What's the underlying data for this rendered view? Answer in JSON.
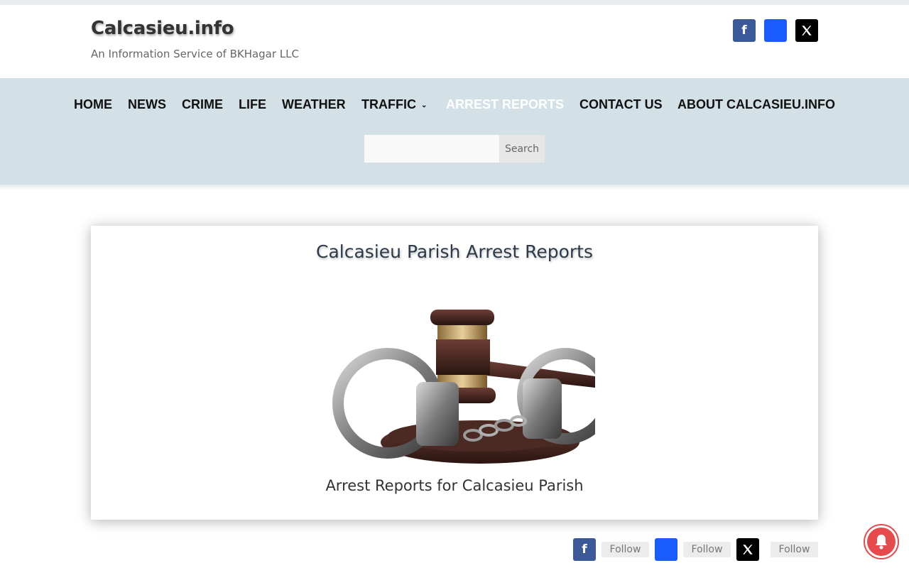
{
  "site": {
    "title": "Calcasieu.info",
    "tagline": "An Information Service of BKHagar LLC"
  },
  "header_social": [
    {
      "icon": "facebook-icon",
      "glyph": "f",
      "color": "#3b5998"
    },
    {
      "icon": "bluesky-icon",
      "glyph": "",
      "color": "#1b5cff"
    },
    {
      "icon": "x-icon",
      "glyph": "𝕏",
      "color": "#000000"
    }
  ],
  "nav": {
    "background": "#d3e0e5",
    "items": [
      {
        "label": "HOME",
        "active": false
      },
      {
        "label": "NEWS",
        "active": false
      },
      {
        "label": "CRIME",
        "active": false
      },
      {
        "label": "LIFE",
        "active": false
      },
      {
        "label": "WEATHER",
        "active": false
      },
      {
        "label": "TRAFFIC",
        "active": false,
        "has_dropdown": true
      },
      {
        "label": "ARREST REPORTS",
        "active": true
      },
      {
        "label": "CONTACT US",
        "active": false
      },
      {
        "label": "ABOUT CALCASIEU.INFO",
        "active": false
      }
    ]
  },
  "search": {
    "value": "",
    "placeholder": "",
    "button_label": "Search"
  },
  "main": {
    "card_title": "Calcasieu Parish Arrest Reports",
    "image_icon": "gavel-handcuffs-image",
    "caption": "Arrest Reports for Calcasieu Parish"
  },
  "follow": {
    "items": [
      {
        "icon": "facebook-icon",
        "glyph": "f",
        "label": "Follow",
        "color": "#3b5998"
      },
      {
        "icon": "bluesky-icon",
        "glyph": "",
        "label": "Follow",
        "color": "#1b5cff"
      },
      {
        "icon": "x-icon",
        "glyph": "𝕏",
        "label": "Follow",
        "color": "#000000"
      }
    ]
  },
  "notification": {
    "icon": "bell-icon",
    "color": "#e54b4d"
  }
}
